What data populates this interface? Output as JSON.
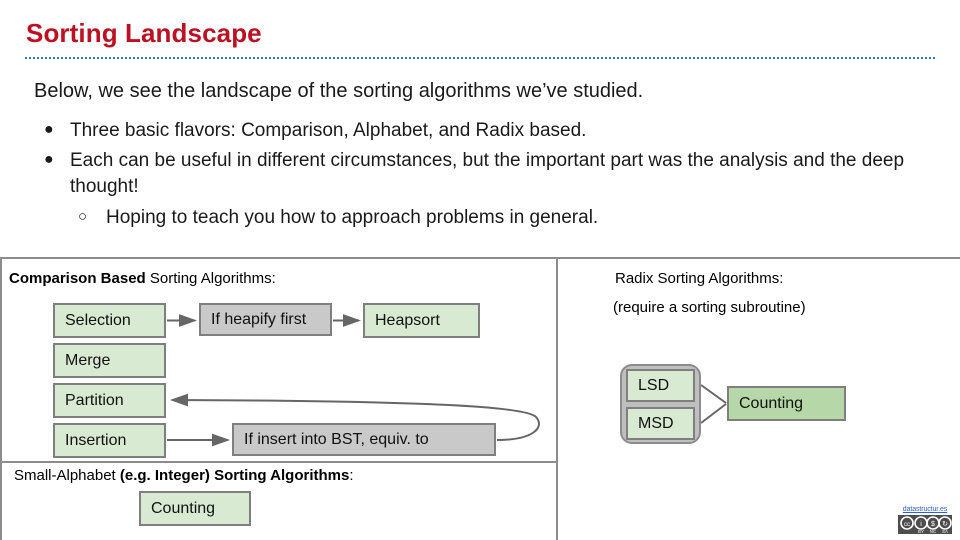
{
  "slide": {
    "title": "Sorting Landscape",
    "lead": "Below, we see the landscape of the sorting algorithms we’ve studied.",
    "bullets": [
      {
        "level": 1,
        "marker": "●",
        "text": "Three basic flavors: Comparison, Alphabet, and Radix based."
      },
      {
        "level": 1,
        "marker": "●",
        "text": "Each can be useful in different circumstances, but the important part was the analysis and the deep thought!"
      },
      {
        "level": 2,
        "marker": "○",
        "text": "Hoping to teach you how to approach problems in general."
      }
    ]
  },
  "diagram": {
    "comparison_section": {
      "caption_bold": "Comparison Based",
      "caption_rest": " Sorting Algorithms:",
      "nodes": [
        {
          "id": "selection",
          "label": "Selection",
          "style": "green-light"
        },
        {
          "id": "merge",
          "label": "Merge",
          "style": "green-light"
        },
        {
          "id": "partition",
          "label": "Partition",
          "style": "green-light"
        },
        {
          "id": "insertion",
          "label": "Insertion",
          "style": "green-light"
        },
        {
          "id": "heapify",
          "label": "If heapify first",
          "style": "gray"
        },
        {
          "id": "heapsort",
          "label": "Heapsort",
          "style": "green-light"
        },
        {
          "id": "bst",
          "label": "If insert into BST, equiv. to",
          "style": "gray"
        }
      ]
    },
    "small_alphabet_section": {
      "caption_rest": "Small-Alphabet ",
      "caption_bold": "(e.g. Integer) Sorting Algorithms",
      "caption_tail": ":",
      "nodes": [
        {
          "id": "counting1",
          "label": "Counting",
          "style": "green-light"
        }
      ]
    },
    "radix_section": {
      "caption_line1": "Radix Sorting Algorithms:",
      "caption_line2": "(require a sorting subroutine)",
      "nodes": [
        {
          "id": "lsd",
          "label": "LSD",
          "style": "green-light"
        },
        {
          "id": "msd",
          "label": "MSD",
          "style": "green-light"
        },
        {
          "id": "counting2",
          "label": "Counting",
          "style": "green-mid"
        }
      ]
    }
  },
  "attribution": {
    "link_text": "datastructur.es",
    "license": "CC BY-NC-SA"
  },
  "colors": {
    "title": "#bb1122",
    "rule": "#2b7bba",
    "green_light": "#d9ead3",
    "green_mid": "#b6d7a8",
    "gray_node": "#c9c9c9",
    "node_border": "#7f7f7f",
    "frame": "#8c8c8c",
    "link": "#2b5fd9"
  }
}
